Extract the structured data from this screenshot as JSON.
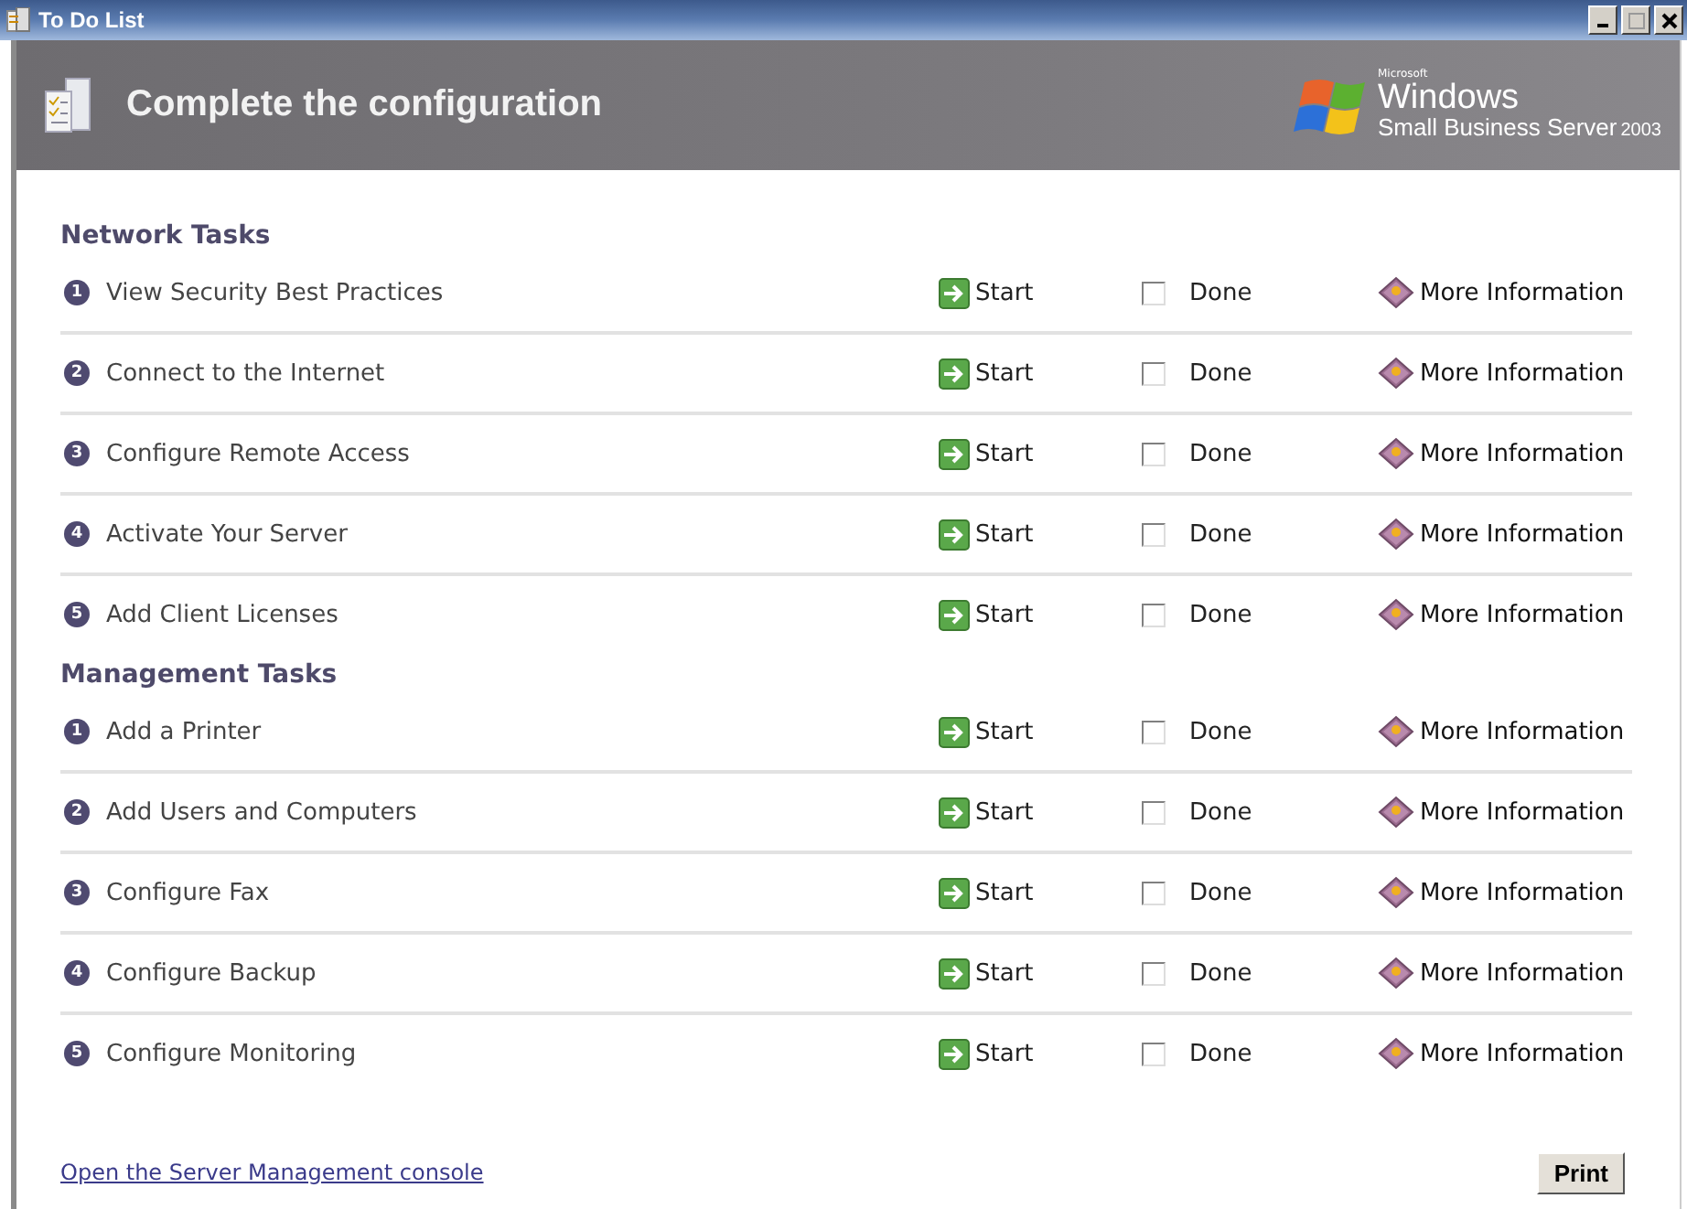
{
  "window": {
    "title": "To Do List"
  },
  "header": {
    "title": "Complete the configuration",
    "logo": {
      "maker": "Microsoft",
      "product": "Windows",
      "edition": "Small Business Server",
      "year": "2003"
    }
  },
  "sections": [
    {
      "title": "Network Tasks",
      "tasks": [
        {
          "number": "1",
          "label": "View Security Best Practices",
          "start": "Start",
          "done": {
            "label": "Done",
            "checked": false
          },
          "more_info": "More Information"
        },
        {
          "number": "2",
          "label": "Connect to the Internet",
          "start": "Start",
          "done": {
            "label": "Done",
            "checked": false
          },
          "more_info": "More Information"
        },
        {
          "number": "3",
          "label": "Configure Remote Access",
          "start": "Start",
          "done": {
            "label": "Done",
            "checked": false
          },
          "more_info": "More Information"
        },
        {
          "number": "4",
          "label": "Activate Your Server",
          "start": "Start",
          "done": {
            "label": "Done",
            "checked": false
          },
          "more_info": "More Information"
        },
        {
          "number": "5",
          "label": "Add Client Licenses",
          "start": "Start",
          "done": {
            "label": "Done",
            "checked": false
          },
          "more_info": "More Information"
        }
      ]
    },
    {
      "title": "Management Tasks",
      "tasks": [
        {
          "number": "1",
          "label": "Add a Printer",
          "start": "Start",
          "done": {
            "label": "Done",
            "checked": false
          },
          "more_info": "More Information"
        },
        {
          "number": "2",
          "label": "Add Users and Computers",
          "start": "Start",
          "done": {
            "label": "Done",
            "checked": false
          },
          "more_info": "More Information"
        },
        {
          "number": "3",
          "label": "Configure Fax",
          "start": "Start",
          "done": {
            "label": "Done",
            "checked": false
          },
          "more_info": "More Information"
        },
        {
          "number": "4",
          "label": "Configure Backup",
          "start": "Start",
          "done": {
            "label": "Done",
            "checked": false
          },
          "more_info": "More Information"
        },
        {
          "number": "5",
          "label": "Configure Monitoring",
          "start": "Start",
          "done": {
            "label": "Done",
            "checked": false
          },
          "more_info": "More Information"
        }
      ]
    }
  ],
  "footer": {
    "link": "Open the Server Management console",
    "print": "Print"
  }
}
